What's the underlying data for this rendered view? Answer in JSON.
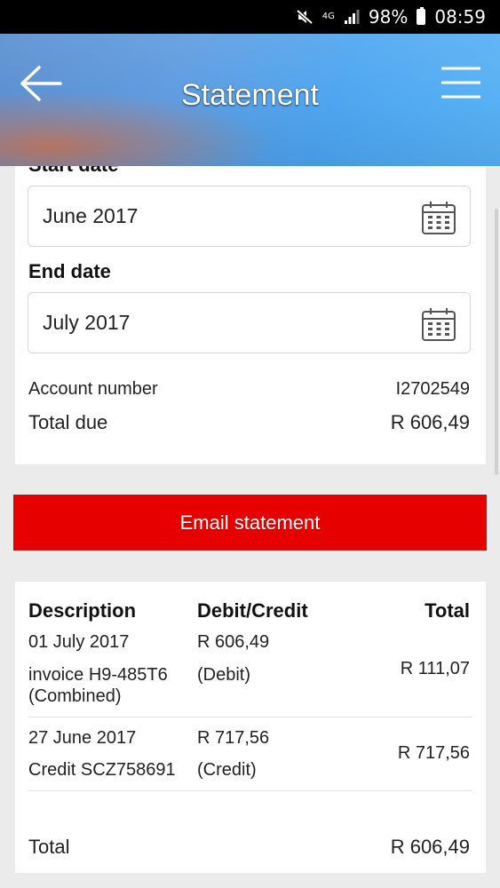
{
  "status_bar": {
    "network": "4G",
    "battery": "98%",
    "time": "08:59"
  },
  "header": {
    "title": "Statement"
  },
  "form": {
    "start_date_label": "Start date",
    "start_date_value": "June 2017",
    "end_date_label": "End date",
    "end_date_value": "July 2017",
    "account_number_label": "Account number",
    "account_number_value": "I2702549",
    "total_due_label": "Total due",
    "total_due_value": "R 606,49"
  },
  "email_button": {
    "label": "Email statement"
  },
  "table": {
    "headers": {
      "description": "Description",
      "debit_credit": "Debit/Credit",
      "total": "Total"
    },
    "rows": [
      {
        "date": "01 July 2017",
        "description": "invoice H9-485T6 (Combined)",
        "amount": "R 606,49",
        "type": "(Debit)",
        "total": "R 111,07"
      },
      {
        "date": "27 June 2017",
        "description": "Credit SCZ758691",
        "amount": "R 717,56",
        "type": "(Credit)",
        "total": "R 717,56"
      }
    ],
    "footer_label": "Total",
    "footer_value": "R 606,49"
  },
  "colors": {
    "accent_red": "#e60000",
    "header_blue": "#5a9ce0"
  },
  "icons": [
    "mute-icon",
    "signal-icon",
    "battery-icon",
    "back-arrow-icon",
    "hamburger-menu-icon",
    "calendar-icon"
  ]
}
